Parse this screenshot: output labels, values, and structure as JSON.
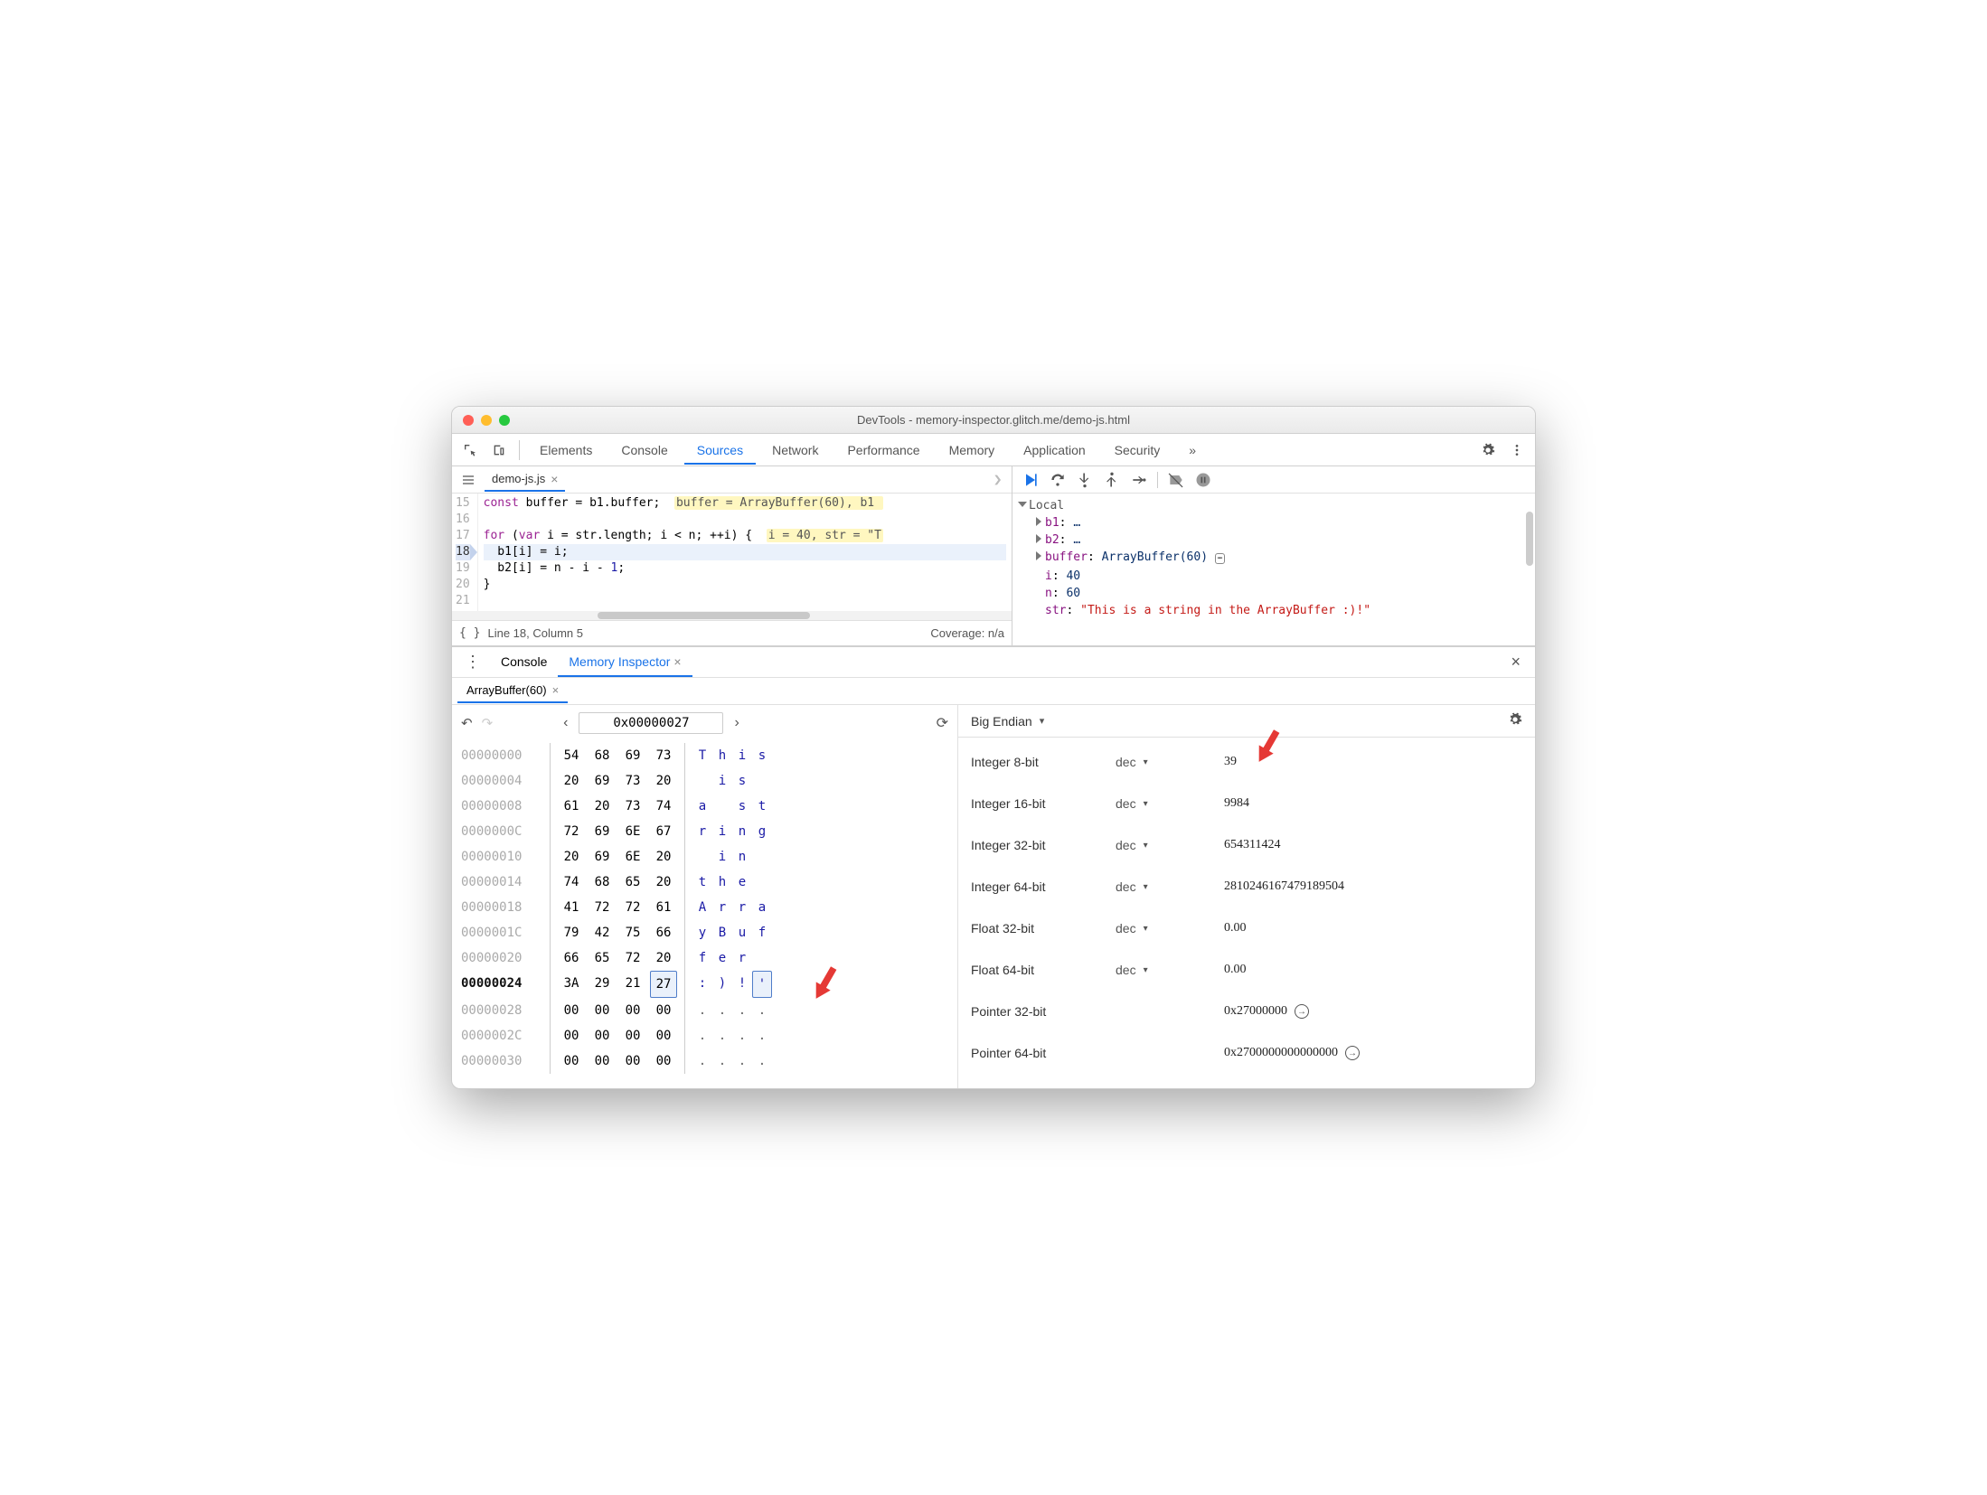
{
  "window": {
    "title": "DevTools - memory-inspector.glitch.me/demo-js.html"
  },
  "main_tabs": {
    "items": [
      "Elements",
      "Console",
      "Sources",
      "Network",
      "Performance",
      "Memory",
      "Application",
      "Security"
    ],
    "active": "Sources",
    "overflow": "»"
  },
  "file_tab": {
    "name": "demo-js.js"
  },
  "code": {
    "gutter": [
      "15",
      "16",
      "17",
      "18",
      "19",
      "20",
      "21"
    ],
    "current_line": "18",
    "lines": [
      {
        "n": "15",
        "pre": "const buffer = b1.buffer;  ",
        "hint": "buffer = ArrayBuffer(60), b1 "
      },
      {
        "n": "16",
        "pre": "",
        "hint": ""
      },
      {
        "n": "17",
        "pre": "for (var i = str.length; i < n; ++i) {  ",
        "hint": "i = 40, str = \"T"
      },
      {
        "n": "18",
        "pre": "  b1[i] = i;",
        "hint": ""
      },
      {
        "n": "19",
        "pre": "  b2[i] = n - i - 1;",
        "hint": ""
      },
      {
        "n": "20",
        "pre": "}",
        "hint": ""
      },
      {
        "n": "21",
        "pre": "",
        "hint": ""
      }
    ]
  },
  "status": {
    "braces": "{ }",
    "pos": "Line 18, Column 5",
    "coverage": "Coverage: n/a"
  },
  "scope": {
    "header": "Local",
    "items": [
      {
        "k": "b1",
        "v": "…",
        "type": "obj"
      },
      {
        "k": "b2",
        "v": "…",
        "type": "obj"
      },
      {
        "k": "buffer",
        "v": "ArrayBuffer(60)",
        "type": "obj",
        "icon": true
      },
      {
        "k": "i",
        "v": "40",
        "type": "num"
      },
      {
        "k": "n",
        "v": "60",
        "type": "num"
      },
      {
        "k": "str",
        "v": "\"This is a string in the ArrayBuffer :)!\"",
        "type": "str"
      }
    ]
  },
  "drawer": {
    "tabs": [
      "Console",
      "Memory Inspector"
    ],
    "active": "Memory Inspector",
    "subtab": "ArrayBuffer(60)"
  },
  "hex": {
    "address": "0x00000027",
    "rows": [
      {
        "addr": "00000000",
        "b": [
          "54",
          "68",
          "69",
          "73"
        ],
        "c": [
          "T",
          "h",
          "i",
          "s"
        ]
      },
      {
        "addr": "00000004",
        "b": [
          "20",
          "69",
          "73",
          "20"
        ],
        "c": [
          " ",
          "i",
          "s",
          " "
        ]
      },
      {
        "addr": "00000008",
        "b": [
          "61",
          "20",
          "73",
          "74"
        ],
        "c": [
          "a",
          " ",
          "s",
          "t"
        ]
      },
      {
        "addr": "0000000C",
        "b": [
          "72",
          "69",
          "6E",
          "67"
        ],
        "c": [
          "r",
          "i",
          "n",
          "g"
        ]
      },
      {
        "addr": "00000010",
        "b": [
          "20",
          "69",
          "6E",
          "20"
        ],
        "c": [
          " ",
          "i",
          "n",
          " "
        ]
      },
      {
        "addr": "00000014",
        "b": [
          "74",
          "68",
          "65",
          "20"
        ],
        "c": [
          "t",
          "h",
          "e",
          " "
        ]
      },
      {
        "addr": "00000018",
        "b": [
          "41",
          "72",
          "72",
          "61"
        ],
        "c": [
          "A",
          "r",
          "r",
          "a"
        ]
      },
      {
        "addr": "0000001C",
        "b": [
          "79",
          "42",
          "75",
          "66"
        ],
        "c": [
          "y",
          "B",
          "u",
          "f"
        ]
      },
      {
        "addr": "00000020",
        "b": [
          "66",
          "65",
          "72",
          "20"
        ],
        "c": [
          "f",
          "e",
          "r",
          " "
        ]
      },
      {
        "addr": "00000024",
        "b": [
          "3A",
          "29",
          "21",
          "27"
        ],
        "c": [
          ":",
          ")",
          "!",
          "'"
        ],
        "sel": 3,
        "cur": true
      },
      {
        "addr": "00000028",
        "b": [
          "00",
          "00",
          "00",
          "00"
        ],
        "c": [
          ".",
          ".",
          ".",
          "."
        ]
      },
      {
        "addr": "0000002C",
        "b": [
          "00",
          "00",
          "00",
          "00"
        ],
        "c": [
          ".",
          ".",
          ".",
          "."
        ]
      },
      {
        "addr": "00000030",
        "b": [
          "00",
          "00",
          "00",
          "00"
        ],
        "c": [
          ".",
          ".",
          ".",
          "."
        ]
      }
    ]
  },
  "values": {
    "endian": "Big Endian",
    "rows": [
      {
        "lbl": "Integer 8-bit",
        "fmt": "dec",
        "val": "39",
        "arrow": true
      },
      {
        "lbl": "Integer 16-bit",
        "fmt": "dec",
        "val": "9984"
      },
      {
        "lbl": "Integer 32-bit",
        "fmt": "dec",
        "val": "654311424"
      },
      {
        "lbl": "Integer 64-bit",
        "fmt": "dec",
        "val": "2810246167479189504"
      },
      {
        "lbl": "Float 32-bit",
        "fmt": "dec",
        "val": "0.00"
      },
      {
        "lbl": "Float 64-bit",
        "fmt": "dec",
        "val": "0.00"
      },
      {
        "lbl": "Pointer 32-bit",
        "fmt": "",
        "val": "0x27000000",
        "goto": true
      },
      {
        "lbl": "Pointer 64-bit",
        "fmt": "",
        "val": "0x2700000000000000",
        "goto": true
      }
    ]
  }
}
